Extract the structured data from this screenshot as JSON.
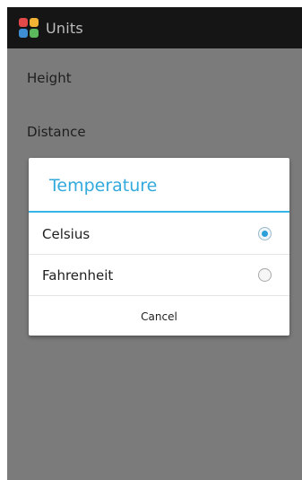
{
  "action_bar": {
    "title": "Units",
    "icon": "units-app-icon",
    "icon_colors": [
      "#e24a4a",
      "#f2b233",
      "#3e8ed6",
      "#5cb85c"
    ]
  },
  "list": {
    "items": [
      {
        "label": "Height"
      },
      {
        "label": "Distance"
      }
    ]
  },
  "dialog": {
    "title": "Temperature",
    "options": [
      {
        "label": "Celsius",
        "selected": true
      },
      {
        "label": "Fahrenheit",
        "selected": false
      }
    ],
    "cancel_label": "Cancel",
    "accent_color": "#33b5e5"
  }
}
